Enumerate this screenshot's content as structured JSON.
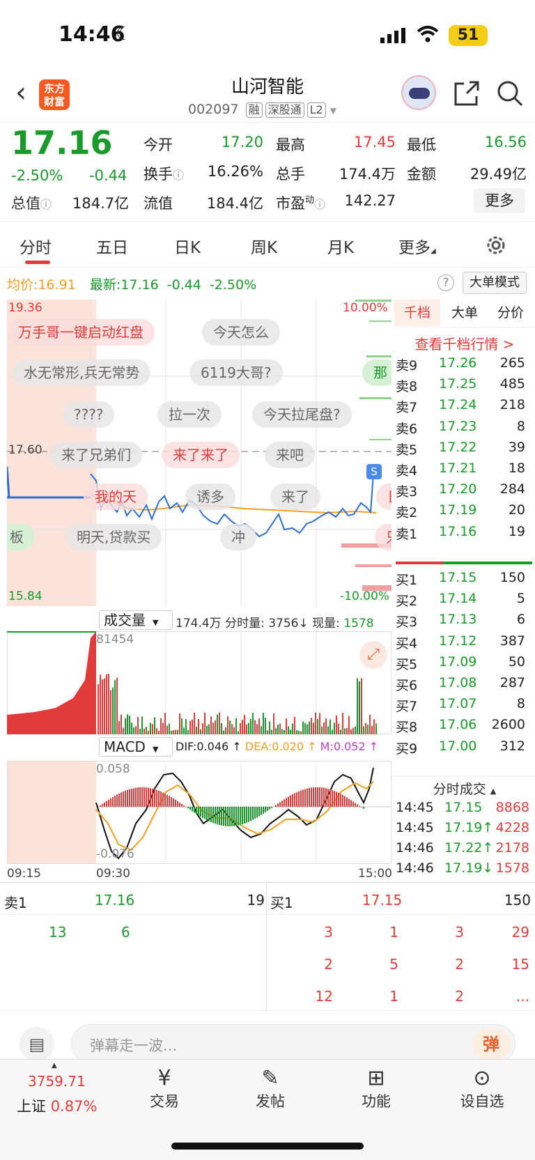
{
  "status_bar": {
    "time": "14:46",
    "battery": "51"
  },
  "header": {
    "logo": "东方财富",
    "title": "山河智能",
    "code": "002097",
    "tags": [
      "融",
      "深股通",
      "L2"
    ]
  },
  "quote": {
    "price": "17.16",
    "change_pct": "-2.50%",
    "change": "-0.44",
    "today_open_label": "今开",
    "today_open": "17.20",
    "high_label": "最高",
    "high": "17.45",
    "low_label": "最低",
    "low": "16.56",
    "turnover_label": "换手",
    "turnover": "16.26%",
    "volume_label": "总手",
    "volume": "174.4万",
    "amount_label": "金额",
    "amount": "29.49亿",
    "mcap_label": "总值",
    "mcap": "184.7亿",
    "float_label": "流值",
    "float": "184.4亿",
    "pe_label": "市盈",
    "pe_sup": "动",
    "pe": "142.27",
    "more": "更多"
  },
  "tabs": [
    "分时",
    "五日",
    "日K",
    "周K",
    "月K",
    "更多",
    "设置"
  ],
  "chart_header": {
    "avg_label": "均价:",
    "avg": "16.91",
    "latest_label": "最新:",
    "latest": "17.16",
    "chg": "-0.44",
    "pct": "-2.50%",
    "big_order_mode": "大单模式"
  },
  "chart_labels": {
    "ymax": "19.36",
    "ymid": "17.60",
    "ymin": "15.84",
    "pmax": "10.00%",
    "pmin": "-10.00%"
  },
  "danmaku": [
    {
      "text": "万手哥一键启动红盘",
      "red": true
    },
    {
      "text": "今天怎么",
      "red": false
    },
    {
      "text": "水无常形,兵无常势",
      "red": false
    },
    {
      "text": "6119大哥?",
      "red": false
    },
    {
      "text": "那",
      "red": false
    },
    {
      "text": "????",
      "red": false
    },
    {
      "text": "拉一次",
      "red": false
    },
    {
      "text": "今天拉尾盘?",
      "red": false
    },
    {
      "text": "来了兄弟们",
      "red": false
    },
    {
      "text": "来了来了",
      "red": true
    },
    {
      "text": "来吧",
      "red": false
    },
    {
      "text": "我的天",
      "red": true
    },
    {
      "text": "诱多",
      "red": false
    },
    {
      "text": "来了",
      "red": false
    },
    {
      "text": "板",
      "red": false
    },
    {
      "text": "明天,贷款买",
      "red": false
    },
    {
      "text": "冲",
      "red": false
    },
    {
      "text": "只",
      "red": true
    },
    {
      "text": "日",
      "red": true
    }
  ],
  "volume_header": {
    "label": "成交量",
    "total": "174.4万",
    "time_vol_label": "分时量:",
    "time_vol": "3756",
    "now_label": "现量:",
    "now": "1578",
    "max": "81454"
  },
  "macd_header": {
    "label": "MACD",
    "dif": "DIF:0.046",
    "dea": "DEA:0.020",
    "m": "M:0.052",
    "ymax": "0.058",
    "ymin": "-0.076"
  },
  "time_axis": [
    "09:15",
    "09:30",
    "15:00"
  ],
  "orderbook": {
    "tabs": [
      "千档",
      "大单",
      "分价"
    ],
    "link": "查看千档行情 >",
    "sells": [
      {
        "label": "卖9",
        "price": "17.26",
        "vol": "265"
      },
      {
        "label": "卖8",
        "price": "17.25",
        "vol": "485"
      },
      {
        "label": "卖7",
        "price": "17.24",
        "vol": "218"
      },
      {
        "label": "卖6",
        "price": "17.23",
        "vol": "8"
      },
      {
        "label": "卖5",
        "price": "17.22",
        "vol": "39"
      },
      {
        "label": "卖4",
        "price": "17.21",
        "vol": "18"
      },
      {
        "label": "卖3",
        "price": "17.20",
        "vol": "284"
      },
      {
        "label": "卖2",
        "price": "17.19",
        "vol": "20"
      },
      {
        "label": "卖1",
        "price": "17.16",
        "vol": "19"
      }
    ],
    "buys": [
      {
        "label": "买1",
        "price": "17.15",
        "vol": "150"
      },
      {
        "label": "买2",
        "price": "17.14",
        "vol": "5"
      },
      {
        "label": "买3",
        "price": "17.13",
        "vol": "6"
      },
      {
        "label": "买4",
        "price": "17.12",
        "vol": "387"
      },
      {
        "label": "买5",
        "price": "17.09",
        "vol": "50"
      },
      {
        "label": "买6",
        "price": "17.08",
        "vol": "287"
      },
      {
        "label": "买7",
        "price": "17.07",
        "vol": "8"
      },
      {
        "label": "买8",
        "price": "17.06",
        "vol": "2600"
      },
      {
        "label": "买9",
        "price": "17.00",
        "vol": "312"
      }
    ],
    "trades_title": "分时成交",
    "trades": [
      {
        "t": "14:45",
        "p": "17.15",
        "v": "8868"
      },
      {
        "t": "14:45",
        "p": "17.19↑",
        "v": "4228"
      },
      {
        "t": "14:46",
        "p": "17.22↑",
        "v": "2178"
      },
      {
        "t": "14:46",
        "p": "17.19↓",
        "v": "1578"
      }
    ]
  },
  "queue": {
    "sell_label": "卖1",
    "sell_price": "17.16",
    "sell_vol": "19",
    "buy_label": "买1",
    "buy_price": "17.15",
    "buy_vol": "150",
    "sell_items": [
      "13",
      "6"
    ],
    "buy_items": [
      "3",
      "1",
      "3",
      "29",
      "2",
      "5",
      "2",
      "15",
      "12",
      "1",
      "2",
      "..."
    ]
  },
  "comment": {
    "placeholder": "弹幕走一波...",
    "send": "弹"
  },
  "nav": {
    "index_value": "3759.71",
    "index_name": "上证",
    "index_pct": "0.87%",
    "items": [
      "交易",
      "发帖",
      "功能",
      "设自选"
    ]
  }
}
